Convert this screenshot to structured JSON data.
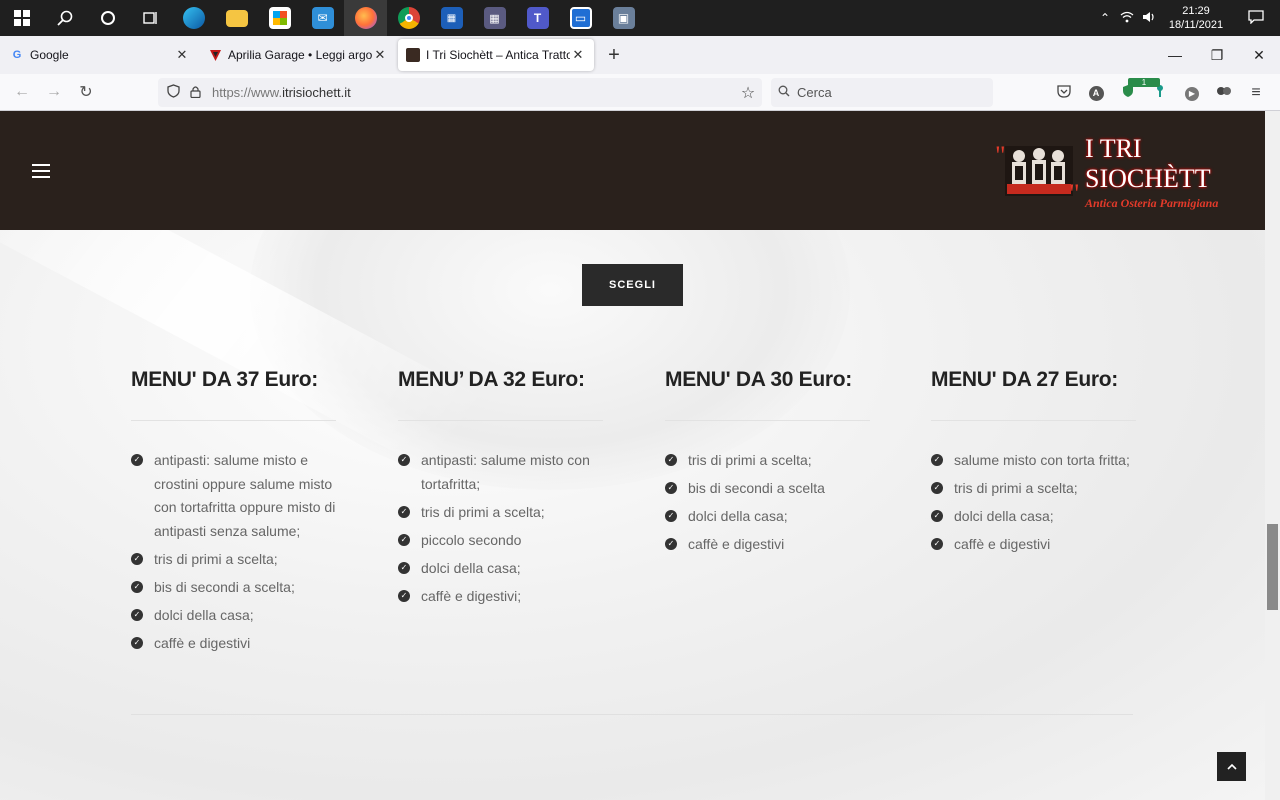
{
  "taskbar": {
    "clock_time": "21:29",
    "clock_date": "18/11/2021"
  },
  "browser": {
    "tabs": [
      {
        "label": "Google",
        "favicon": "G"
      },
      {
        "label": "Aprilia Garage • Leggi argomento",
        "favicon": "A"
      },
      {
        "label": "I Tri Siochètt – Antica Trattoria Parmigiana",
        "favicon": "T"
      }
    ],
    "url_scheme": "https://www.",
    "url_host": "itrisiochett.it",
    "search_placeholder": "Cerca",
    "ext_badge": "1"
  },
  "site": {
    "logo_title": "I TRI SIOCHÈTT",
    "logo_subtitle": "Antica Osteria Parmigiana",
    "scegli_label": "SCEGLI",
    "menus": [
      {
        "title": "MENU' DA 37 Euro:",
        "items": [
          "antipasti: salume misto e crostini oppure salume misto con tortafritta oppure misto di antipasti senza salume;",
          "tris di primi a scelta;",
          "bis di secondi a scelta;",
          "dolci della casa;",
          "caffè e digestivi"
        ]
      },
      {
        "title": "MENU’ DA 32 Euro:",
        "items": [
          "antipasti: salume misto con tortafritta;",
          "tris di primi a scelta;",
          "piccolo secondo",
          "dolci della casa;",
          "caffè e digestivi;"
        ]
      },
      {
        "title": "MENU' DA 30 Euro:",
        "items": [
          "tris di primi a scelta;",
          "bis di secondi a scelta",
          "dolci della casa;",
          "caffè e digestivi"
        ]
      },
      {
        "title": "MENU' DA 27 Euro:",
        "items": [
          "salume misto con torta fritta;",
          "tris di primi a scelta;",
          "dolci della casa;",
          "caffè e digestivi"
        ]
      }
    ]
  },
  "colors": {
    "header_bg": "#2a211c",
    "button_bg": "#2a2a2a",
    "logo_accent": "#e23a2a"
  }
}
